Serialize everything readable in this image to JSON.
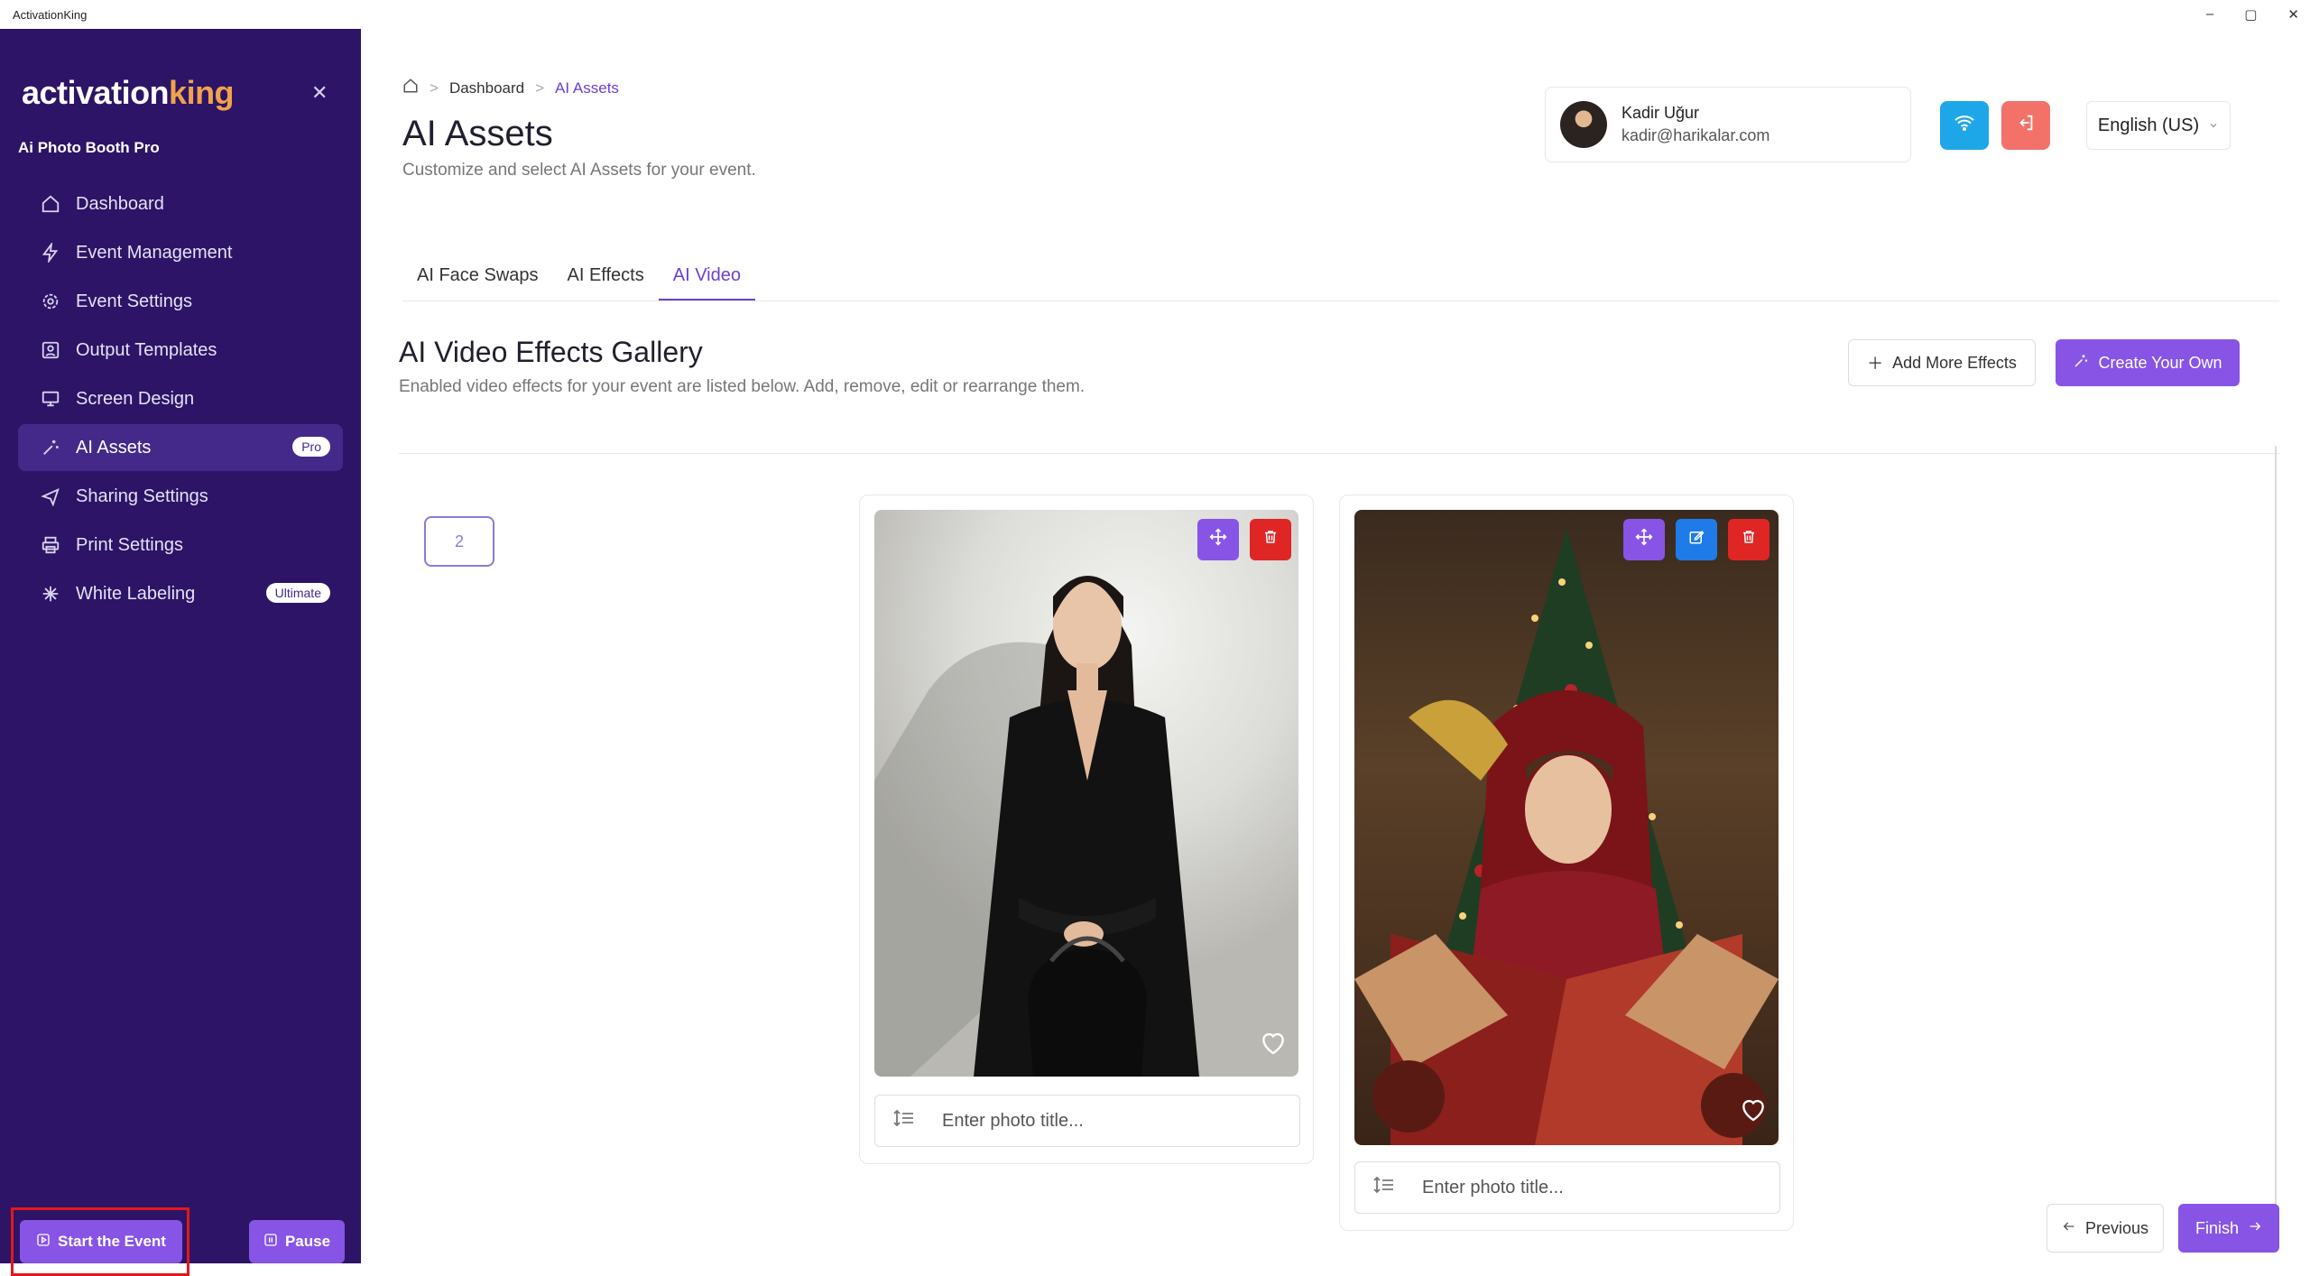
{
  "window": {
    "title": "ActivationKing",
    "controls": [
      "–",
      "▢",
      "✕"
    ]
  },
  "sidebar": {
    "logo_a": "activation",
    "logo_b": "king",
    "subtitle": "Ai Photo Booth Pro",
    "items": [
      {
        "label": "Dashboard",
        "icon": "home-icon"
      },
      {
        "label": "Event Management",
        "icon": "bolt-icon"
      },
      {
        "label": "Event Settings",
        "icon": "gear-icon"
      },
      {
        "label": "Output Templates",
        "icon": "portrait-icon"
      },
      {
        "label": "Screen Design",
        "icon": "monitor-icon"
      },
      {
        "label": "AI Assets",
        "icon": "sparkle-wand-icon",
        "badge": "Pro"
      },
      {
        "label": "Sharing Settings",
        "icon": "send-icon"
      },
      {
        "label": "Print Settings",
        "icon": "printer-icon"
      },
      {
        "label": "White Labeling",
        "icon": "asterisk-icon",
        "badge": "Ultimate"
      }
    ],
    "start_label": "Start the Event",
    "pause_label": "Pause"
  },
  "breadcrumb": {
    "home": "home",
    "items": [
      "Dashboard",
      "AI Assets"
    ]
  },
  "page": {
    "title": "AI Assets",
    "subtitle": "Customize and select AI Assets for your event."
  },
  "user": {
    "name": "Kadir Uğur",
    "email": "kadir@harikalar.com"
  },
  "language": {
    "selected": "English (US)"
  },
  "tabs": [
    "AI Face Swaps",
    "AI Effects",
    "AI Video"
  ],
  "gallery": {
    "title": "AI Video Effects Gallery",
    "subtitle": "Enabled video effects for your event are listed below. Add, remove, edit or rearrange them.",
    "add_label": "Add More Effects",
    "create_label": "Create Your Own",
    "count": "2",
    "cards": [
      {
        "placeholder": "Enter photo title..."
      },
      {
        "placeholder": "Enter photo title..."
      }
    ]
  },
  "footer": {
    "prev_label": "Previous",
    "finish_label": "Finish"
  },
  "colors": {
    "sidebar": "#2d1466",
    "accent": "#8754e6",
    "danger": "#e02525",
    "info": "#1ea7e8",
    "logout": "#f2726a"
  }
}
